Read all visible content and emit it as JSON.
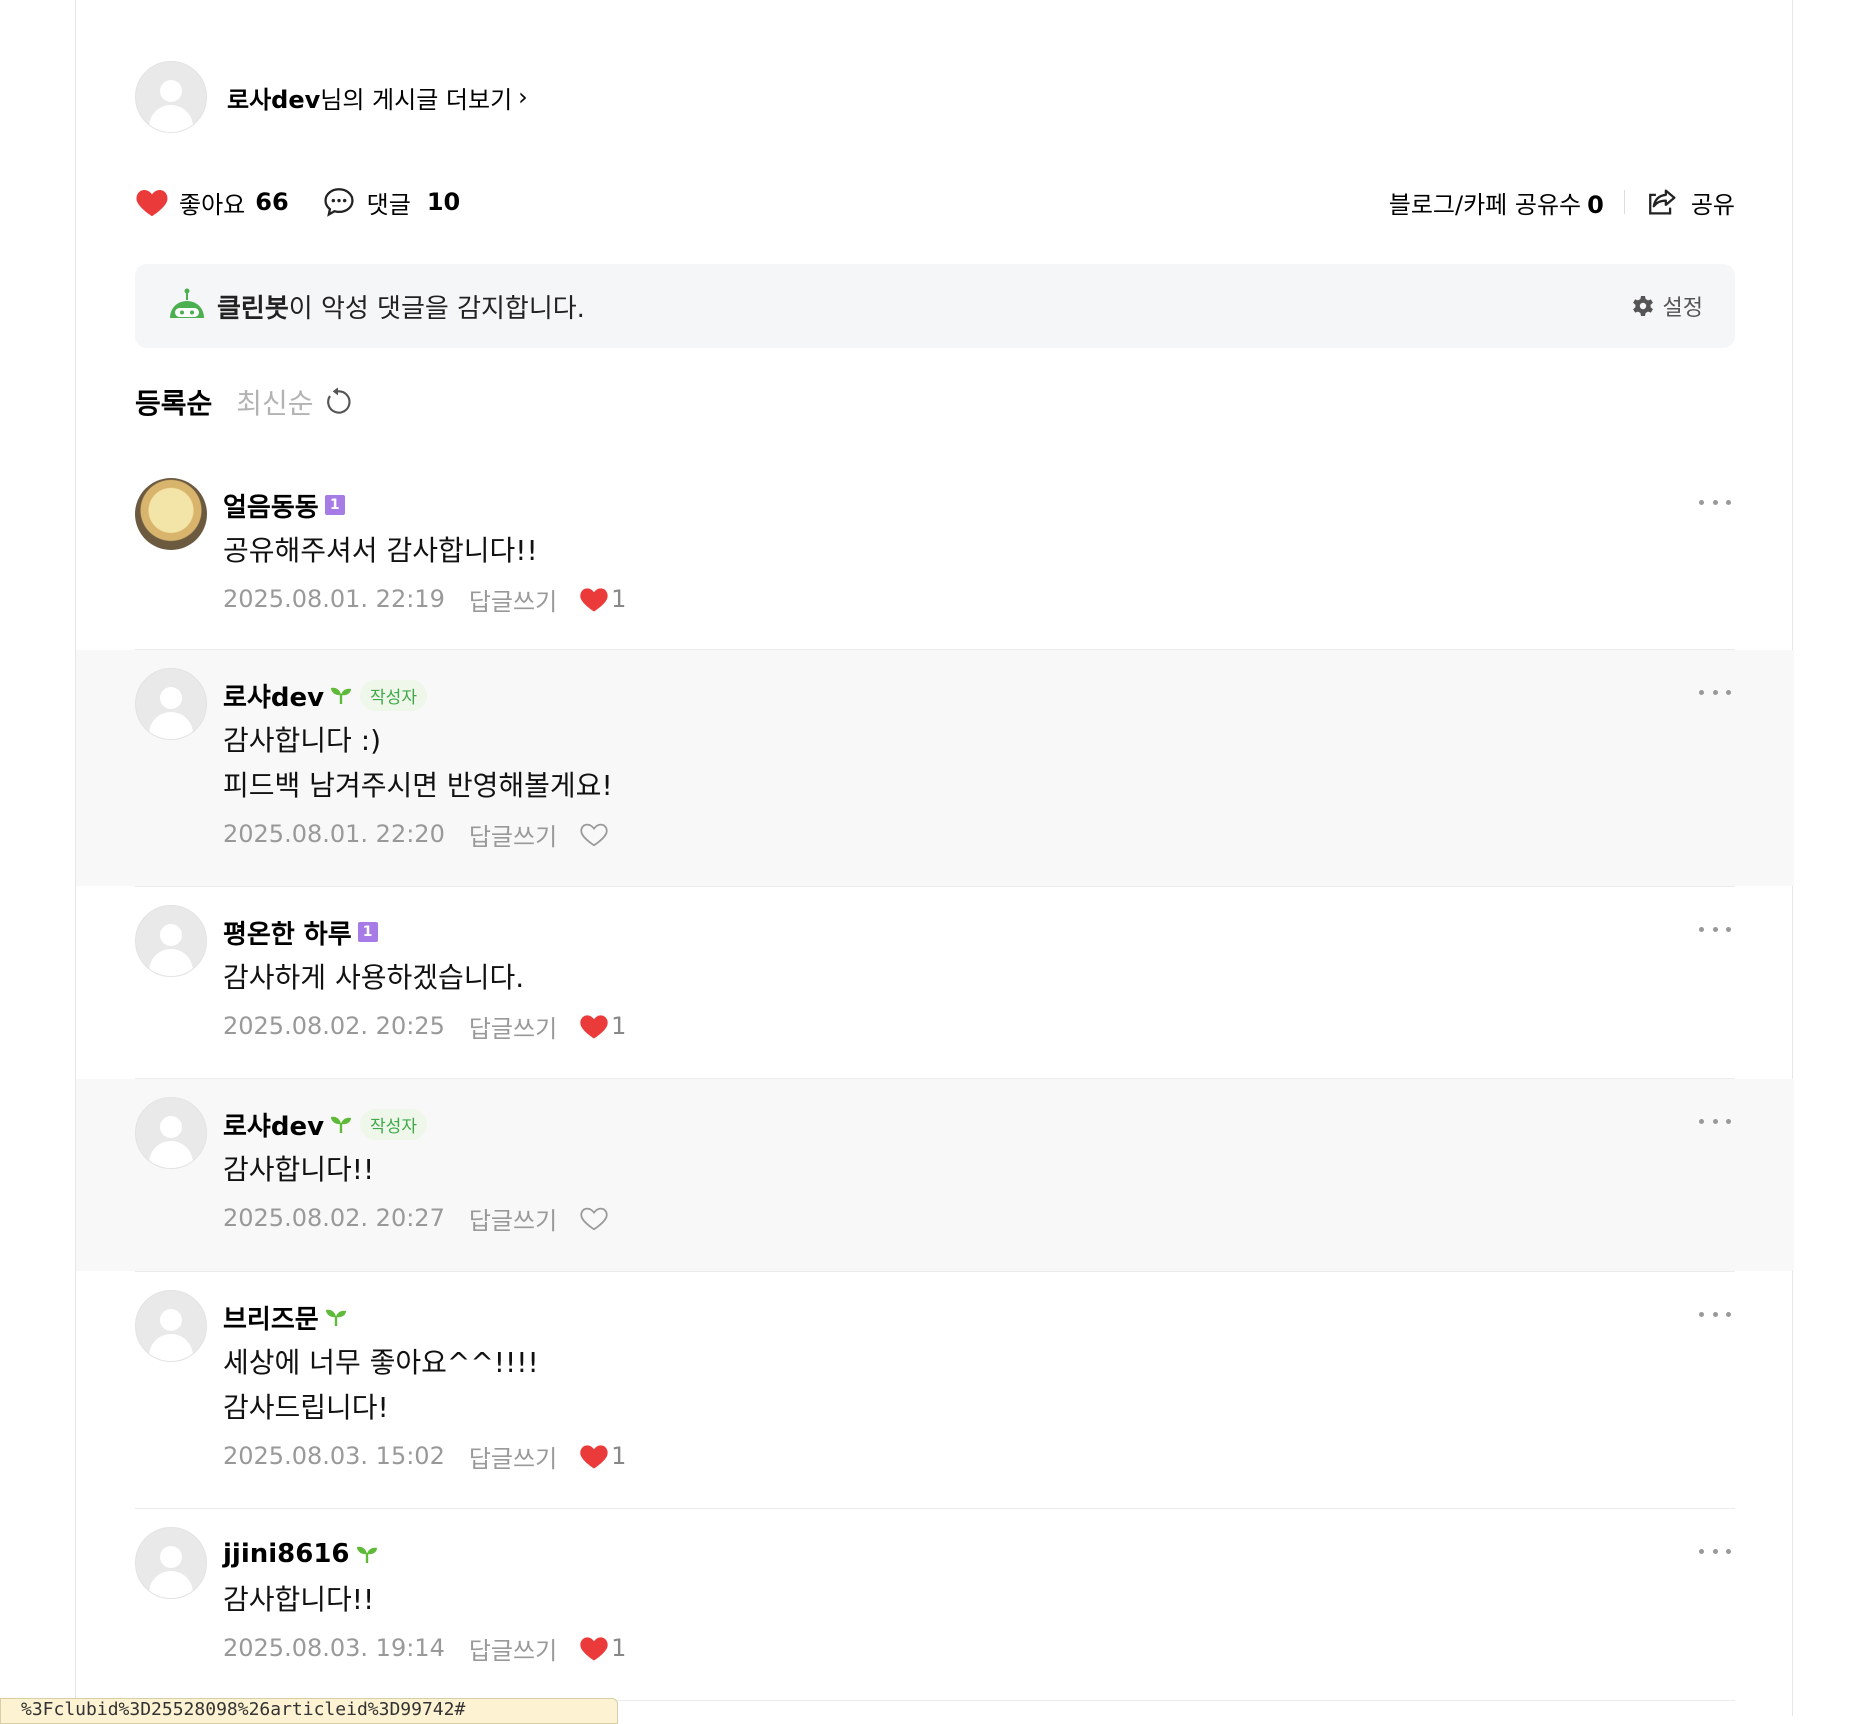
{
  "author": {
    "name": "로사dev",
    "suffix": "님의 게시글 더보기",
    "chevron": "›"
  },
  "stats": {
    "like_label": "좋아요",
    "like_count": "66",
    "comment_label": "댓글",
    "comment_count": "10",
    "share_count_label": "블로그/카페 공유수",
    "share_count": "0",
    "share_label": "공유"
  },
  "cleanbot": {
    "name": "클린봇",
    "message": "이 악성 댓글을 감지합니다.",
    "settings_label": "설정"
  },
  "sort": {
    "active": "등록순",
    "inactive": "최신순"
  },
  "comments": [
    {
      "name": "얼음동동",
      "level": "1",
      "grade": "level",
      "is_writer": false,
      "lines": [
        "공유해주셔서 감사합니다!!"
      ],
      "date": "2025.08.01. 22:19",
      "reply_label": "답글쓰기",
      "liked": true,
      "likes": "1"
    },
    {
      "name": "로샤dev",
      "grade": "sprout",
      "is_writer": true,
      "writer_label": "작성자",
      "lines": [
        "감사합니다 :)",
        "피드백 남겨주시면 반영해볼게요!"
      ],
      "date": "2025.08.01. 22:20",
      "reply_label": "답글쓰기",
      "liked": false,
      "likes": ""
    },
    {
      "name": "평온한 하루",
      "level": "1",
      "grade": "level",
      "is_writer": false,
      "lines": [
        "감사하게 사용하겠습니다."
      ],
      "date": "2025.08.02. 20:25",
      "reply_label": "답글쓰기",
      "liked": true,
      "likes": "1"
    },
    {
      "name": "로샤dev",
      "grade": "sprout",
      "is_writer": true,
      "writer_label": "작성자",
      "lines": [
        "감사합니다!!"
      ],
      "date": "2025.08.02. 20:27",
      "reply_label": "답글쓰기",
      "liked": false,
      "likes": ""
    },
    {
      "name": "브리즈문",
      "grade": "sprout",
      "is_writer": false,
      "lines": [
        "세상에 너무 좋아요^^!!!!",
        "감사드립니다!"
      ],
      "date": "2025.08.03. 15:02",
      "reply_label": "답글쓰기",
      "liked": true,
      "likes": "1"
    },
    {
      "name": "jjini8616",
      "grade": "sprout",
      "is_writer": false,
      "lines": [
        "감사합니다!!"
      ],
      "date": "2025.08.03. 19:14",
      "reply_label": "답글쓰기",
      "liked": true,
      "likes": "1"
    }
  ],
  "status_url": "%3Fclubid%3D25528098%26articleid%3D99742#",
  "colors": {
    "heart": "#ea3a3a",
    "sprout": "#5fba3a",
    "level_badge": "#a77be6",
    "writer_badge_text": "#3fa94a",
    "cleanbot_green": "#4caf50"
  }
}
